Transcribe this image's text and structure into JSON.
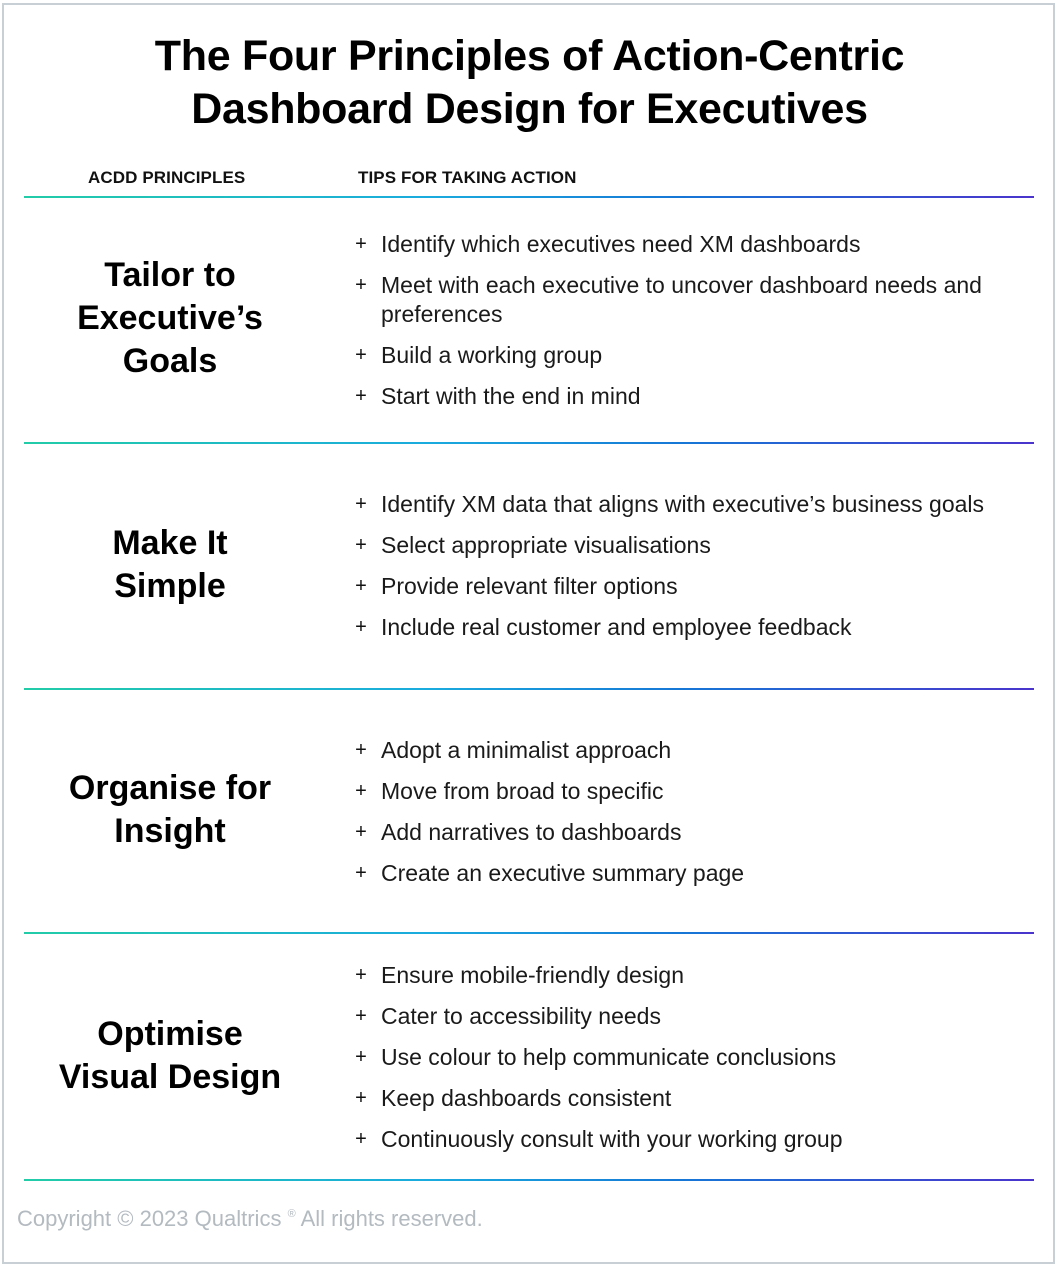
{
  "title": {
    "line1": "The Four Principles of Action-Centric",
    "line2": "Dashboard Design for Executives"
  },
  "columns": {
    "left": "ACDD PRINCIPLES",
    "right": "TIPS FOR TAKING ACTION"
  },
  "bullet_icon": "+",
  "rule_colors": {
    "start": "#22cca8",
    "middle": "#1677d6",
    "end": "#4a34cc"
  },
  "sections": [
    {
      "principle_lines": [
        "Tailor to",
        "Executive’s",
        "Goals"
      ],
      "tips": [
        "Identify which executives need XM dashboards",
        "Meet with each executive to uncover dashboard needs and preferences",
        "Build a working group",
        "Start with the end in mind"
      ]
    },
    {
      "principle_lines": [
        "Make It",
        "Simple"
      ],
      "tips": [
        "Identify XM data that aligns with executive’s business goals",
        "Select appropriate visualisations",
        "Provide relevant filter options",
        "Include real customer and employee feedback"
      ]
    },
    {
      "principle_lines": [
        "Organise for",
        "Insight"
      ],
      "tips": [
        "Adopt a minimalist approach",
        "Move from broad to specific",
        "Add narratives to dashboards",
        "Create an executive summary page"
      ]
    },
    {
      "principle_lines": [
        "Optimise",
        "Visual Design"
      ],
      "tips": [
        "Ensure mobile-friendly design",
        "Cater to accessibility needs",
        "Use colour to help communicate conclusions",
        "Keep dashboards consistent",
        "Continuously consult with your working group"
      ]
    }
  ],
  "footer": {
    "text_before": "Copyright © 2023 Qualtrics ",
    "registered": "®",
    "text_after": " All rights reserved."
  }
}
